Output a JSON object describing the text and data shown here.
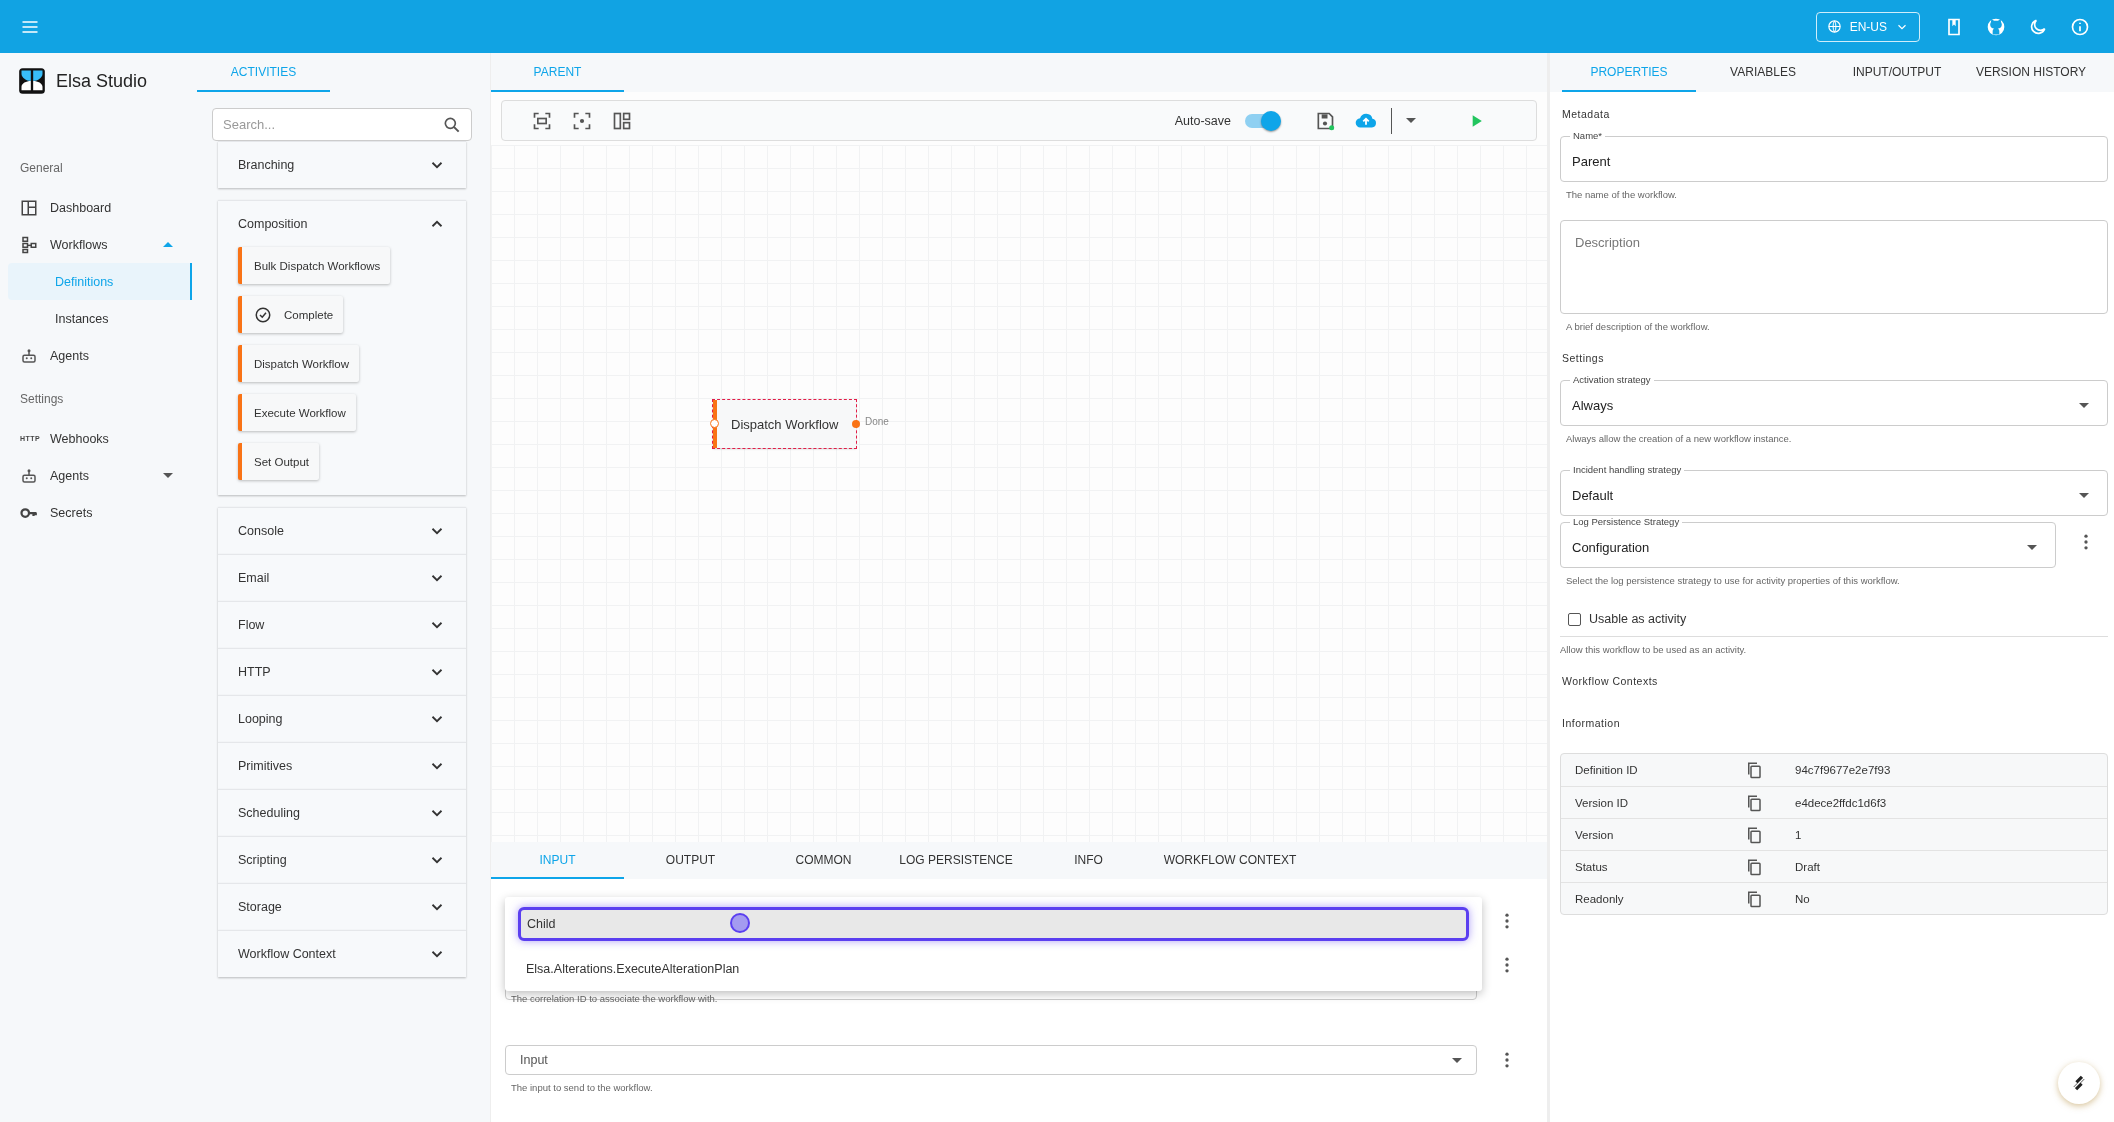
{
  "app_bar": {
    "language": "EN-US"
  },
  "nav": {
    "brand": "Elsa Studio",
    "sections": [
      {
        "heading": "General",
        "items": [
          {
            "label": "Dashboard",
            "kind": "link",
            "selected": false
          },
          {
            "label": "Workflows",
            "kind": "group",
            "selected": false,
            "expanded": true,
            "children": [
              {
                "label": "Definitions",
                "selected": true
              },
              {
                "label": "Instances",
                "selected": false
              }
            ]
          },
          {
            "label": "Agents",
            "kind": "link",
            "selected": false
          }
        ]
      },
      {
        "heading": "Settings",
        "items": [
          {
            "label": "Webhooks",
            "kind": "link",
            "selected": false,
            "icon_text": "HTTP"
          },
          {
            "label": "Agents",
            "kind": "group",
            "selected": false,
            "expanded": false
          },
          {
            "label": "Secrets",
            "kind": "link",
            "selected": false
          }
        ]
      }
    ]
  },
  "activities": {
    "tabs": [
      {
        "label": "ACTIVITIES",
        "selected": true
      }
    ],
    "search": {
      "placeholder": "Search..."
    },
    "categories": [
      {
        "label": "Branching",
        "expanded": false
      },
      {
        "label": "Composition",
        "expanded": true,
        "activities": [
          {
            "label": "Bulk Dispatch Workflows",
            "kind": "plain"
          },
          {
            "label": "Complete",
            "kind": "with_icon"
          },
          {
            "label": "Dispatch Workflow",
            "kind": "plain"
          },
          {
            "label": "Execute Workflow",
            "kind": "plain"
          },
          {
            "label": "Set Output",
            "kind": "plain"
          }
        ]
      },
      {
        "label": "Console",
        "expanded": false
      },
      {
        "label": "Email",
        "expanded": false
      },
      {
        "label": "Flow",
        "expanded": false
      },
      {
        "label": "HTTP",
        "expanded": false
      },
      {
        "label": "Looping",
        "expanded": false
      },
      {
        "label": "Primitives",
        "expanded": false
      },
      {
        "label": "Scheduling",
        "expanded": false
      },
      {
        "label": "Scripting",
        "expanded": false
      },
      {
        "label": "Storage",
        "expanded": false
      },
      {
        "label": "Workflow Context",
        "expanded": false
      }
    ]
  },
  "designer": {
    "tabs": [
      {
        "label": "PARENT",
        "selected": true
      }
    ],
    "toolbar": {
      "auto_save": {
        "label": "Auto-save",
        "on": true
      }
    },
    "canvas": {
      "nodes": [
        {
          "label": "Dispatch Workflow",
          "selected": true,
          "outcome": "Done"
        }
      ]
    }
  },
  "activity_panel": {
    "tabs": [
      {
        "label": "INPUT",
        "selected": true
      },
      {
        "label": "OUTPUT",
        "selected": false
      },
      {
        "label": "COMMON",
        "selected": false
      },
      {
        "label": "LOG PERSISTENCE",
        "selected": false
      },
      {
        "label": "INFO",
        "selected": false
      },
      {
        "label": "WORKFLOW CONTEXT",
        "selected": false
      }
    ],
    "definition_dropdown": {
      "options": [
        {
          "label": "Child",
          "selected": true
        },
        {
          "label": "Elsa.Alterations.ExecuteAlterationPlan",
          "selected": false
        }
      ]
    },
    "correlation": {
      "helper": "The correlation ID to associate the workflow with."
    },
    "input": {
      "placeholder": "Input",
      "helper": "The input to send to the workflow."
    }
  },
  "properties": {
    "tabs": [
      {
        "label": "PROPERTIES",
        "selected": true
      },
      {
        "label": "VARIABLES",
        "selected": false
      },
      {
        "label": "INPUT/OUTPUT",
        "selected": false
      },
      {
        "label": "VERSION HISTORY",
        "selected": false
      }
    ],
    "metadata": {
      "heading": "Metadata",
      "name": {
        "label": "Name*",
        "value": "Parent",
        "helper": "The name of the workflow."
      },
      "description": {
        "placeholder": "Description",
        "helper": "A brief description of the workflow."
      }
    },
    "settings": {
      "heading": "Settings",
      "activation": {
        "label": "Activation strategy",
        "value": "Always",
        "helper": "Always allow the creation of a new workflow instance."
      },
      "incident": {
        "label": "Incident handling strategy",
        "value": "Default"
      },
      "log_persistence": {
        "label": "Log Persistence Strategy",
        "value": "Configuration",
        "helper": "Select the log persistence strategy to use for activity properties of this workflow."
      },
      "usable_as_activity": {
        "label": "Usable as activity",
        "checked": false,
        "helper": "Allow this workflow to be used as an activity."
      }
    },
    "workflow_contexts": {
      "heading": "Workflow Contexts"
    },
    "information": {
      "heading": "Information",
      "rows": [
        {
          "label": "Definition ID",
          "value": "94c7f9677e2e7f93"
        },
        {
          "label": "Version ID",
          "value": "e4dece2ffdc1d6f3"
        },
        {
          "label": "Version",
          "value": "1"
        },
        {
          "label": "Status",
          "value": "Draft"
        },
        {
          "label": "Readonly",
          "value": "No"
        }
      ]
    }
  }
}
